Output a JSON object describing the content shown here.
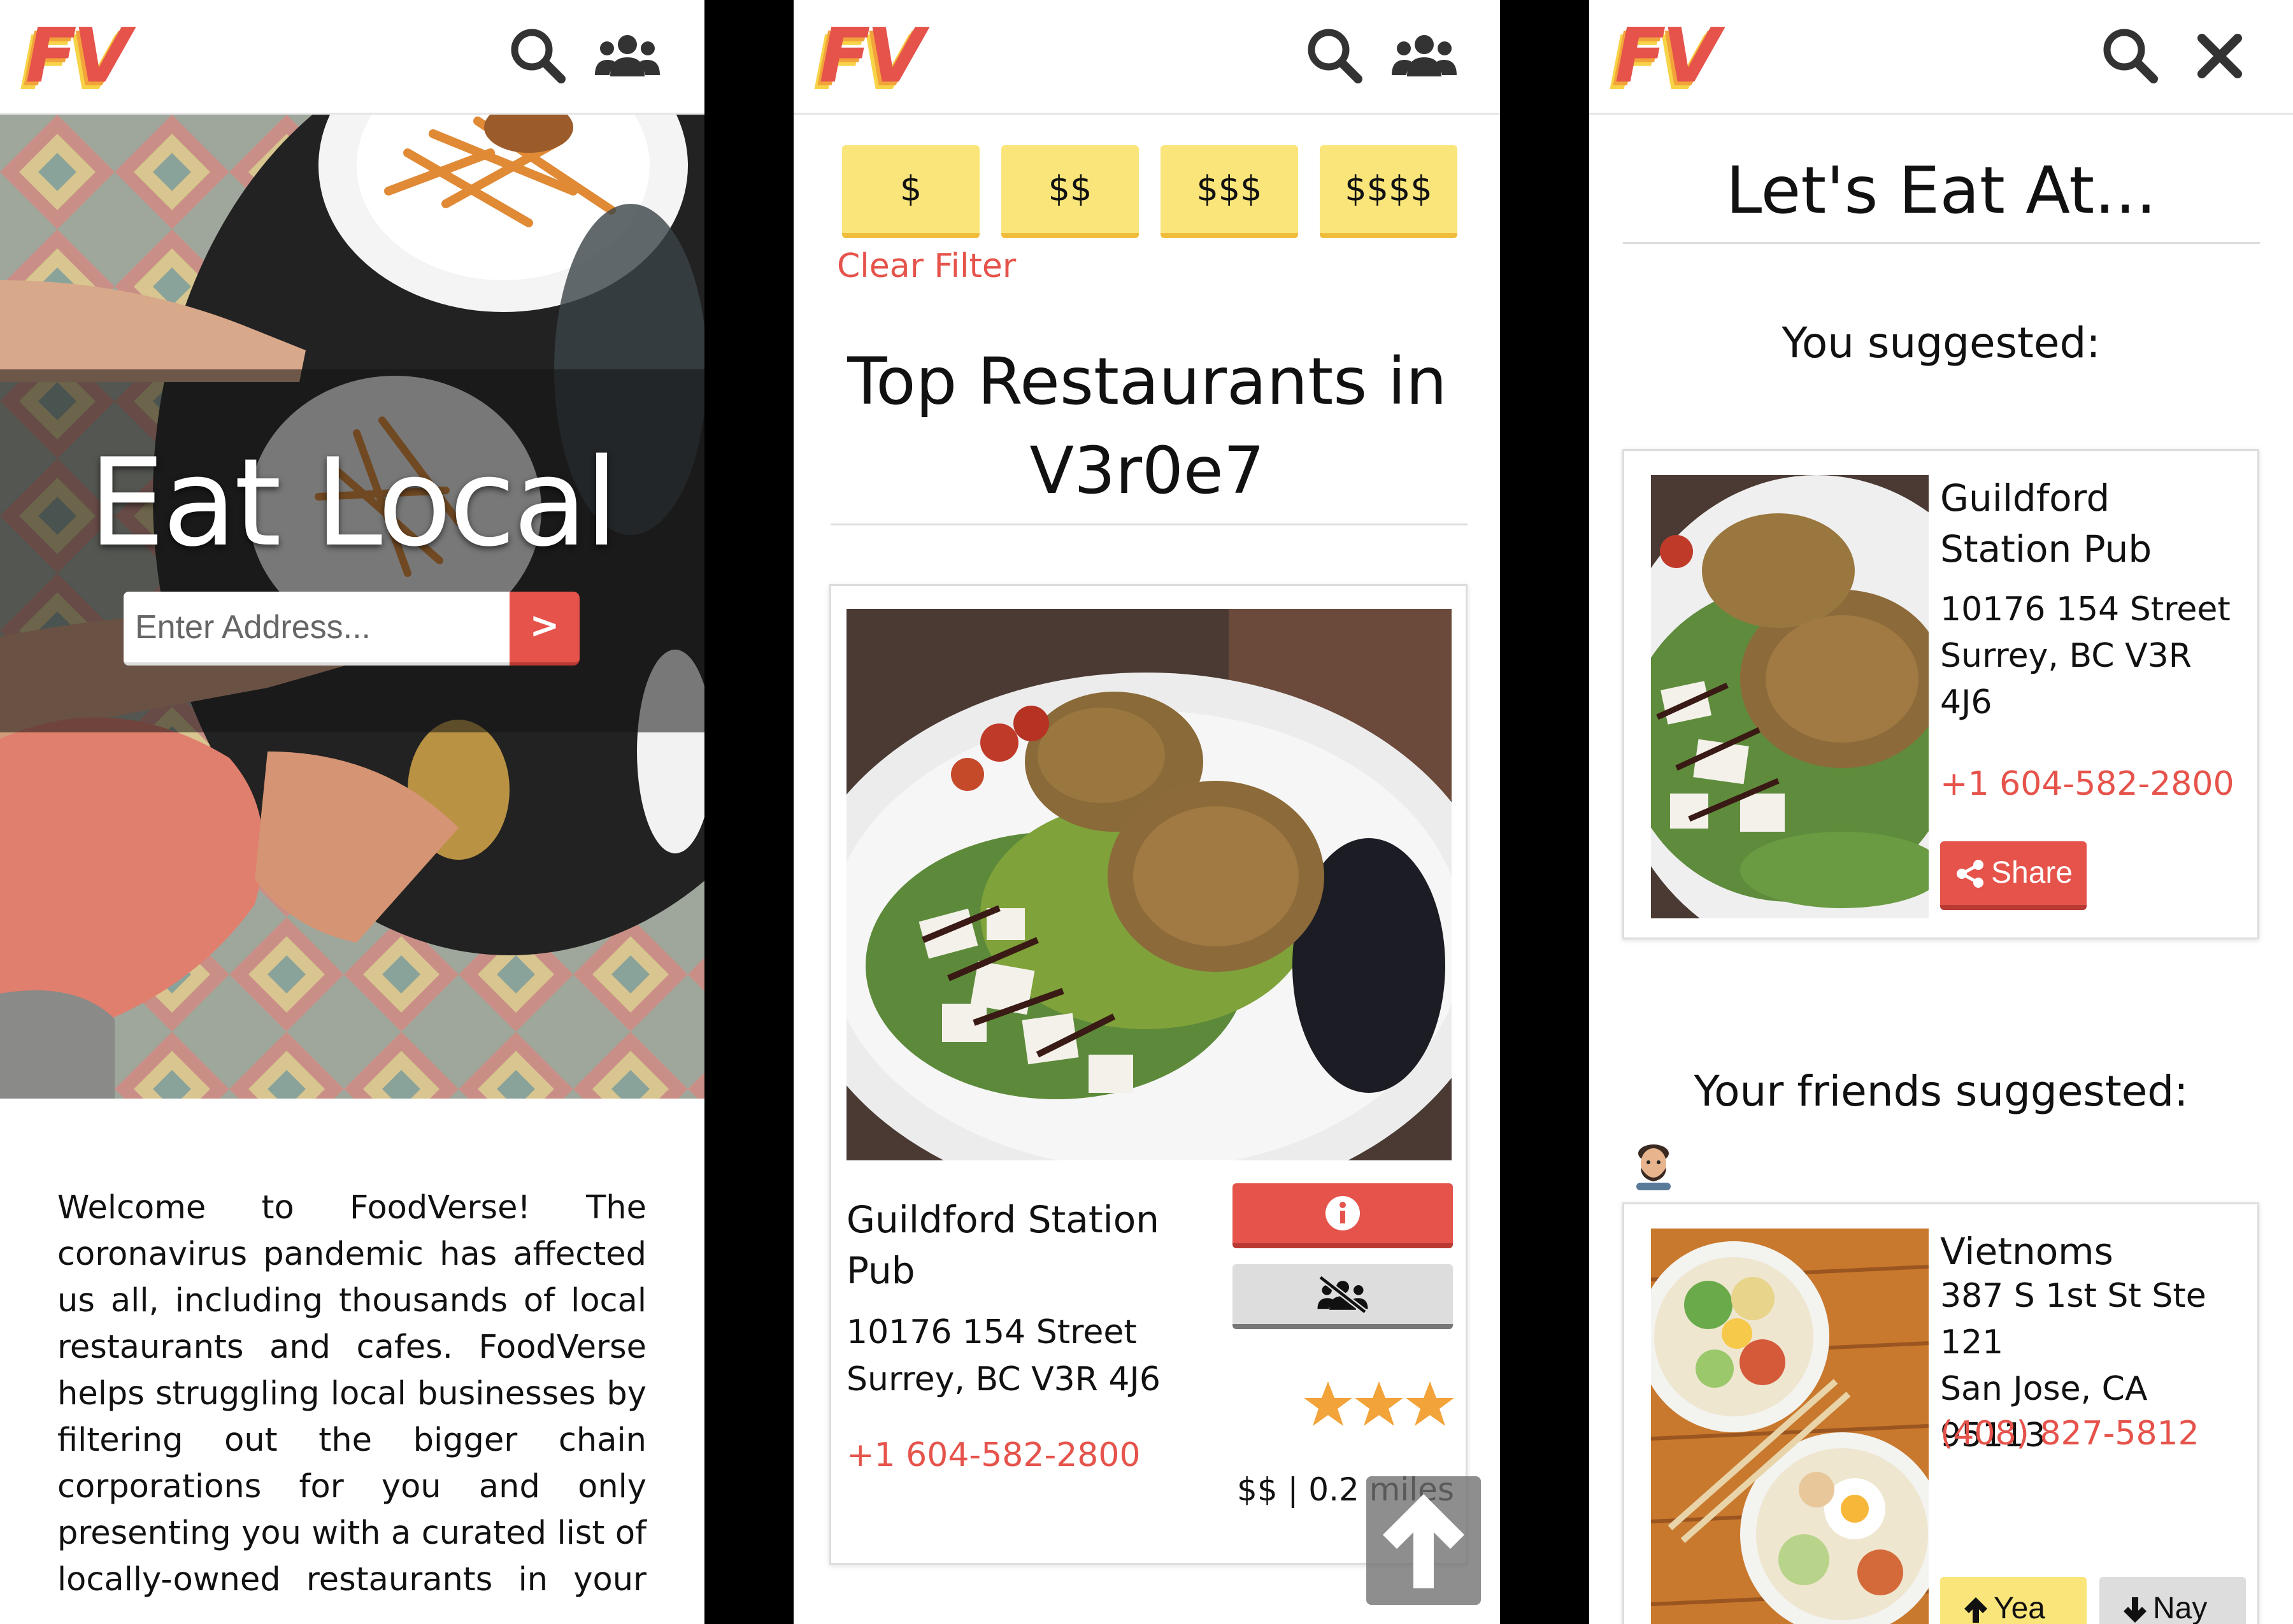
{
  "brand": {
    "logo_text": "FV",
    "colors": {
      "red": "#e5534b",
      "orange": "#f2a33a",
      "yellow": "#f7d348",
      "button_yellow": "#f9e57a",
      "gray": "#dddddd"
    }
  },
  "home": {
    "header_icons": [
      "search-icon",
      "users-icon"
    ],
    "hero_title": "Eat Local",
    "address_placeholder": "Enter Address...",
    "go_label": ">",
    "welcome_text": "Welcome to FoodVerse! The coronavirus pandemic has affected us all, including thousands of local restaurants and cafes. FoodVerse helps struggling local businesses by filtering out the bigger chain corporations for you and only presenting you with a curated list of locally-owned restaurants in your"
  },
  "results": {
    "header_icons": [
      "search-icon",
      "users-icon"
    ],
    "price_filters": [
      "$",
      "$$",
      "$$$",
      "$$$$"
    ],
    "clear_filter": "Clear Filter",
    "title": "Top Restaurants in V3r0e7",
    "restaurant": {
      "name": "Guildford Station Pub",
      "address_line1": "10176 154 Street",
      "address_line2": "Surrey, BC V3R 4J6",
      "phone": "+1 604-582-2800",
      "rating": 3,
      "price": "$$",
      "distance": "0.2 miles"
    }
  },
  "group": {
    "header_icons": [
      "search-icon",
      "close-icon"
    ],
    "title": "Let's Eat At...",
    "you_suggested": "You suggested:",
    "my_pick": {
      "name": "Guildford Station Pub",
      "address": "10176 154 Street Surrey, BC V3R 4J6",
      "phone": "+1 604-582-2800",
      "share_label": "Share"
    },
    "friends_suggested": "Your friends suggested:",
    "friend_pick": {
      "name": "Vietnoms",
      "address_line1": "387 S 1st St Ste 121",
      "address_line2": "San Jose, CA 95113",
      "phone": "(408) 827-5812",
      "yea_label": "Yea",
      "nay_label": "Nay"
    }
  }
}
